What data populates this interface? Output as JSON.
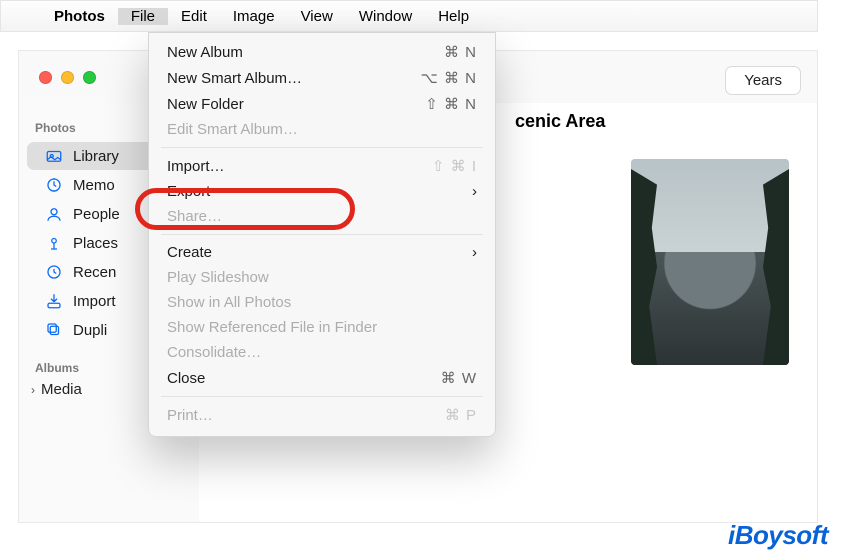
{
  "menubar": {
    "appname": "Photos",
    "items": [
      "File",
      "Edit",
      "Image",
      "View",
      "Window",
      "Help"
    ],
    "active": "File"
  },
  "window": {
    "toolbar": {
      "years_btn": "Years"
    }
  },
  "sidebar": {
    "sections": [
      {
        "title": "Photos",
        "items": [
          {
            "icon": "library-icon",
            "label": "Library",
            "selected": true
          },
          {
            "icon": "memories-icon",
            "label": "Memo"
          },
          {
            "icon": "people-icon",
            "label": "People"
          },
          {
            "icon": "places-icon",
            "label": "Places"
          },
          {
            "icon": "recents-icon",
            "label": "Recen"
          },
          {
            "icon": "imports-icon",
            "label": "Import"
          },
          {
            "icon": "duplicates-icon",
            "label": "Dupli"
          }
        ]
      },
      {
        "title": "Albums",
        "items": [
          {
            "icon": "chevron-right-icon",
            "label": "Media"
          }
        ]
      }
    ]
  },
  "content": {
    "heading_fragment": "cenic Area"
  },
  "file_menu": [
    {
      "label": "New Album",
      "shortcut": "⌘ N",
      "enabled": true
    },
    {
      "label": "New Smart Album…",
      "shortcut": "⌥ ⌘ N",
      "enabled": true
    },
    {
      "label": "New Folder",
      "shortcut": "⇧ ⌘ N",
      "enabled": true
    },
    {
      "label": "Edit Smart Album…",
      "shortcut": "",
      "enabled": false
    },
    {
      "divider": true
    },
    {
      "label": "Import…",
      "shortcut": "⇧ ⌘ I",
      "enabled": true,
      "highlighted": true
    },
    {
      "label": "Export",
      "submenu": true,
      "enabled": true
    },
    {
      "label": "Share…",
      "enabled": false
    },
    {
      "divider": true
    },
    {
      "label": "Create",
      "submenu": true,
      "enabled": true
    },
    {
      "label": "Play Slideshow",
      "enabled": false
    },
    {
      "label": "Show in All Photos",
      "enabled": false
    },
    {
      "label": "Show Referenced File in Finder",
      "enabled": false
    },
    {
      "label": "Consolidate…",
      "enabled": false
    },
    {
      "label": "Close",
      "shortcut": "⌘ W",
      "enabled": true
    },
    {
      "divider": true
    },
    {
      "label": "Print…",
      "shortcut": "⌘ P",
      "enabled": false
    }
  ],
  "brand": "iBoysoft"
}
